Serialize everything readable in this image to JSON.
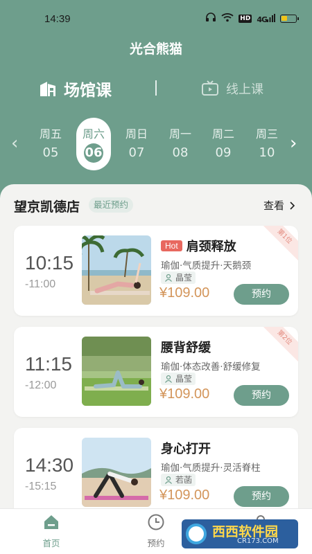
{
  "status_bar": {
    "time": "14:39",
    "icons": [
      "headphones-icon",
      "wifi-icon",
      "hd-icon",
      "signal-icon",
      "battery-icon"
    ],
    "hd_label": "HD",
    "signal_label": "4G"
  },
  "app_title": "光合熊猫",
  "mode_tabs": [
    {
      "label": "场馆课",
      "icon": "building-icon",
      "active": true
    },
    {
      "label": "线上课",
      "icon": "tv-icon",
      "active": false
    }
  ],
  "dates": [
    {
      "weekday": "周五",
      "day": "05"
    },
    {
      "weekday": "周六",
      "day": "06",
      "selected": true
    },
    {
      "weekday": "周日",
      "day": "07"
    },
    {
      "weekday": "周一",
      "day": "08"
    },
    {
      "weekday": "周二",
      "day": "09"
    },
    {
      "weekday": "周三",
      "day": "10"
    }
  ],
  "store": {
    "name": "望京凯德店",
    "badge": "最近预约",
    "view_label": "查看"
  },
  "classes": [
    {
      "start": "10:15",
      "end": "-11:00",
      "hot_label": "Hot",
      "title": "肩颈释放",
      "tags": "瑜伽·气质提升·天鹅颈",
      "coach": "晶莹",
      "price": "¥109.00",
      "book_label": "预约",
      "rank": "第1位"
    },
    {
      "start": "11:15",
      "end": "-12:00",
      "title": "腰背舒缓",
      "tags": "瑜伽·体态改善·舒缓修复",
      "coach": "晶莹",
      "price": "¥109.00",
      "book_label": "预约",
      "rank": "第2位"
    },
    {
      "start": "14:30",
      "end": "-15:15",
      "title": "身心打开",
      "tags": "瑜伽·气质提升·灵活脊柱",
      "coach": "若菡",
      "price": "¥109.00",
      "book_label": "预约"
    }
  ],
  "bottom_nav": [
    {
      "label": "首页",
      "icon": "home-icon",
      "active": true
    },
    {
      "label": "预约",
      "icon": "clock-icon"
    },
    {
      "label": "",
      "icon": "profile-icon"
    }
  ],
  "watermark": {
    "main": "西西软件园",
    "sub": "CR173.COM"
  },
  "colors": {
    "primary": "#6e9e8c",
    "price": "#d3955a",
    "hot": "#e8685f",
    "background": "#f3f3f1"
  }
}
